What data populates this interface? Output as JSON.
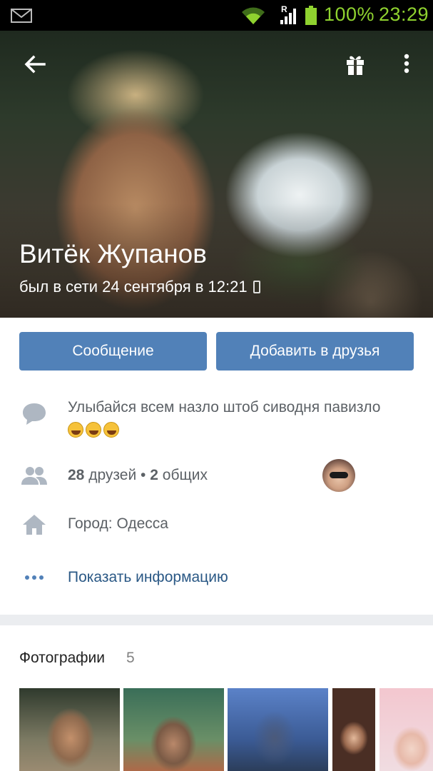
{
  "status_bar": {
    "icons": [
      "mail-icon",
      "wifi-icon",
      "signal-icon",
      "battery-icon"
    ],
    "roaming": "R",
    "battery": "100%",
    "time": "23:29"
  },
  "cover": {
    "icons": [
      "back-arrow-icon",
      "gift-icon",
      "more-vert-icon"
    ],
    "name": "Витёк Жупанов",
    "last_seen": "был в сети 24 сентября в 12:21"
  },
  "actions": {
    "message": "Сообщение",
    "add_friend": "Добавить в друзья"
  },
  "info": {
    "status_icon": "comment-icon",
    "status_text": "Улыбайся всем назло штоб сиводня павизло",
    "status_emoji_count": 3,
    "friends_icon": "people-icon",
    "friends_count": "28",
    "friends_label": "друзей",
    "separator": "•",
    "mutual_count": "2",
    "mutual_label": "общих",
    "city_icon": "home-icon",
    "city": "Город: Одесса",
    "more_icon": "dots-icon",
    "show_info": "Показать информацию"
  },
  "photos": {
    "title": "Фотографии",
    "count": "5"
  },
  "colors": {
    "accent": "#5181b8",
    "link": "#2a5885",
    "status_green": "#8fd22f"
  }
}
